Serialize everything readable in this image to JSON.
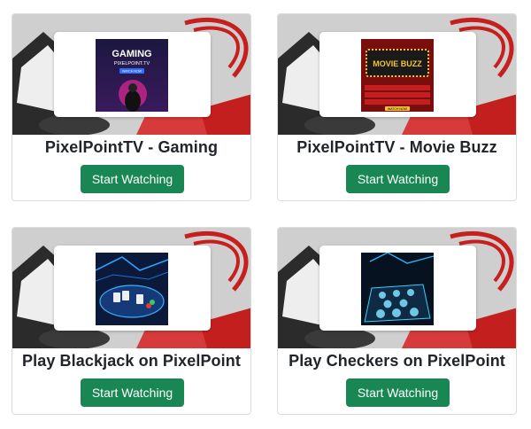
{
  "cards": [
    {
      "title": "PixelPointTV - Gaming",
      "button_label": "Start Watching",
      "thumb_text": "GAMING",
      "thumb_sub": "PIXELPOINT.TV",
      "thumb_cta": "WATCH NOW"
    },
    {
      "title": "PixelPointTV - Movie Buzz",
      "button_label": "Start Watching",
      "thumb_text": "MOVIE BUZZ",
      "thumb_cta": "WATCH NOW"
    },
    {
      "title": "Play Blackjack on PixelPoint",
      "button_label": "Start Watching"
    },
    {
      "title": "Play Checkers on PixelPoint",
      "button_label": "Start Watching"
    }
  ],
  "colors": {
    "button": "#198754",
    "title": "#212529",
    "card_border": "#dcdcdc"
  }
}
